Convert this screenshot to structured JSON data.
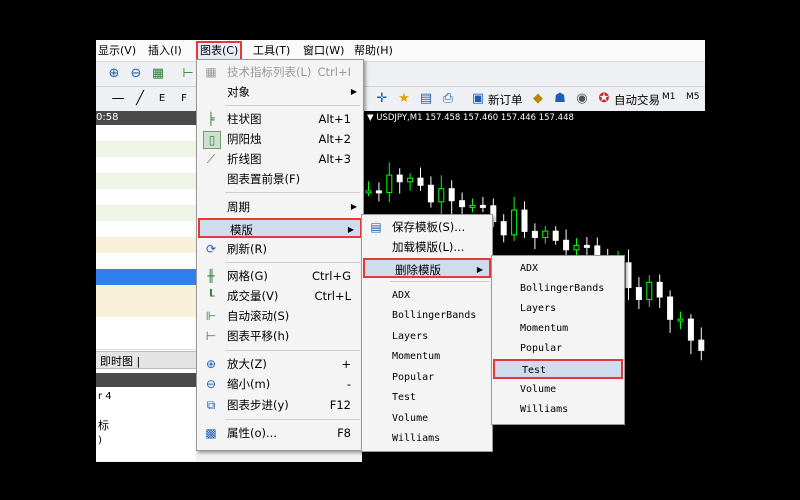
{
  "menubar": {
    "items": [
      "显示(V)",
      "插入(I)",
      "图表(C)",
      "工具(T)",
      "窗口(W)",
      "帮助(H)"
    ]
  },
  "toolbar": {
    "new_order": "新订单",
    "auto_trade": "自动交易",
    "tf_m1": "M1",
    "tf_m5": "M5"
  },
  "left_panel": {
    "time": "0:58",
    "tab_label": "即时图 |",
    "text_1": "r 4",
    "text_2": "标",
    "text_3": ")"
  },
  "chart": {
    "header": "▼ USDJPY,M1  157.458 157.460 157.446 157.448",
    "colors": {
      "up": "#00ff00",
      "down": "#ffffff",
      "bg": "#000000"
    }
  },
  "chart_menu": {
    "items": [
      {
        "icon": "list-icon",
        "label": "技术指标列表(L)",
        "shortcut": "Ctrl+I",
        "disabled": true
      },
      {
        "icon": "",
        "label": "对象",
        "shortcut": "",
        "submenu": true
      },
      {
        "icon": "bar-chart-icon",
        "label": "柱状图",
        "shortcut": "Alt+1"
      },
      {
        "icon": "candlestick-icon",
        "label": "阴阳烛",
        "shortcut": "Alt+2"
      },
      {
        "icon": "line-chart-icon",
        "label": "折线图",
        "shortcut": "Alt+3"
      },
      {
        "icon": "",
        "label": "图表置前景(F)",
        "shortcut": ""
      },
      {
        "icon": "",
        "label": "周期",
        "shortcut": "",
        "submenu": true
      },
      {
        "icon": "",
        "label": "模版",
        "shortcut": "",
        "submenu": true
      },
      {
        "icon": "refresh-icon",
        "label": "刷新(R)",
        "shortcut": ""
      },
      {
        "icon": "grid-icon",
        "label": "网格(G)",
        "shortcut": "Ctrl+G"
      },
      {
        "icon": "volume-icon",
        "label": "成交量(V)",
        "shortcut": "Ctrl+L"
      },
      {
        "icon": "autoscroll-icon",
        "label": "自动滚动(S)",
        "shortcut": ""
      },
      {
        "icon": "chart-shift-icon",
        "label": "图表平移(h)",
        "shortcut": ""
      },
      {
        "icon": "zoom-in-icon",
        "label": "放大(Z)",
        "shortcut": "+"
      },
      {
        "icon": "zoom-out-icon",
        "label": "缩小(m)",
        "shortcut": "-"
      },
      {
        "icon": "step-icon",
        "label": "图表步进(y)",
        "shortcut": "F12"
      },
      {
        "icon": "properties-icon",
        "label": "属性(o)...",
        "shortcut": "F8"
      }
    ]
  },
  "template_menu": {
    "items": [
      "保存模板(S)...",
      "加载模版(L)...",
      "删除模版"
    ],
    "templates": [
      "ADX",
      "BollingerBands",
      "Layers",
      "Momentum",
      "Popular",
      "Test",
      "Volume",
      "Williams"
    ]
  },
  "delete_menu": {
    "templates": [
      "ADX",
      "BollingerBands",
      "Layers",
      "Momentum",
      "Popular",
      "Test",
      "Volume",
      "Williams"
    ]
  }
}
